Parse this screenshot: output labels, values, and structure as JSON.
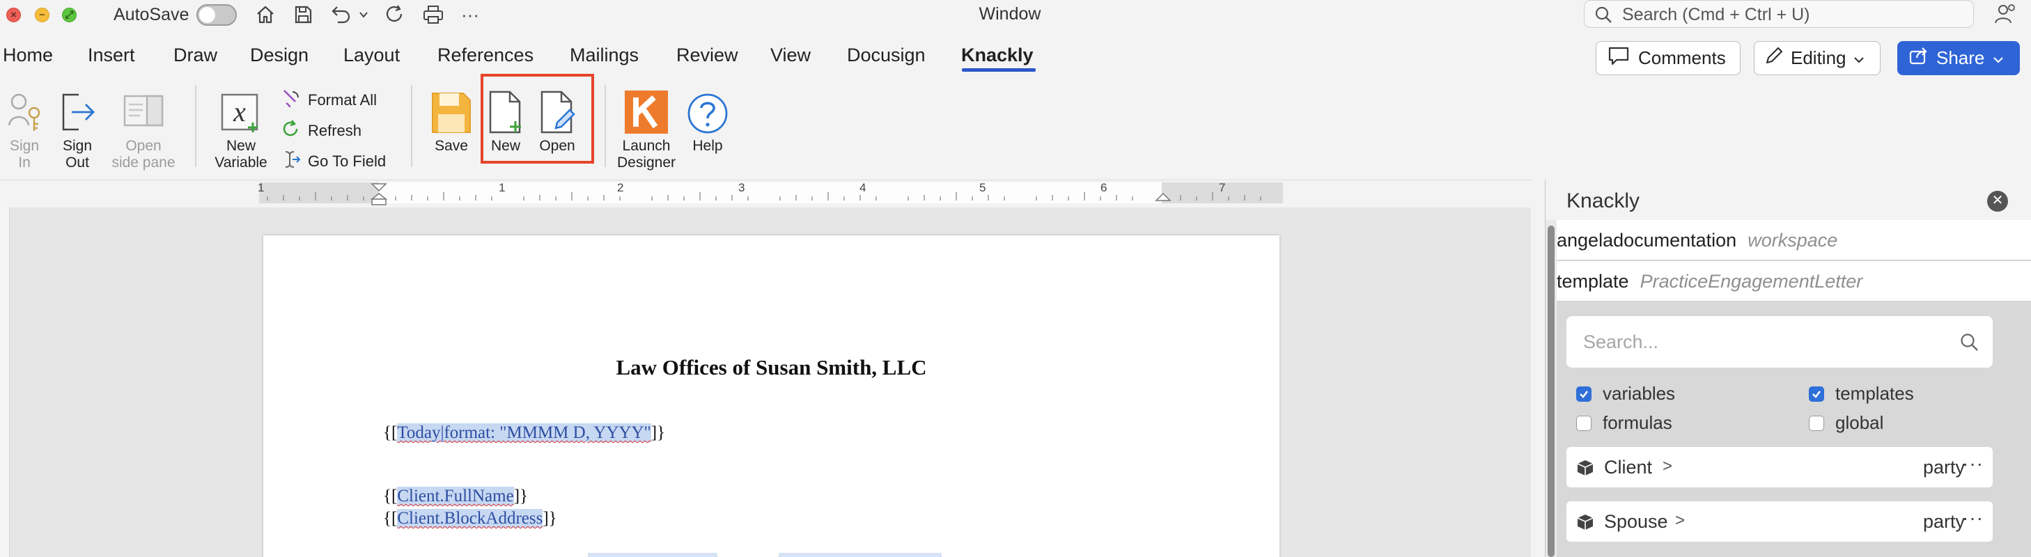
{
  "titlebar": {
    "autosave_label": "AutoSave",
    "window_title": "Window",
    "search_placeholder": "Search (Cmd + Ctrl + U)"
  },
  "tabs": [
    {
      "label": "Home"
    },
    {
      "label": "Insert"
    },
    {
      "label": "Draw"
    },
    {
      "label": "Design"
    },
    {
      "label": "Layout"
    },
    {
      "label": "References"
    },
    {
      "label": "Mailings"
    },
    {
      "label": "Review"
    },
    {
      "label": "View"
    },
    {
      "label": "Docusign"
    },
    {
      "label": "Knackly",
      "active": true
    }
  ],
  "actions": {
    "comments": "Comments",
    "editing": "Editing",
    "share": "Share"
  },
  "ribbon": {
    "sign_in": [
      "Sign",
      "In"
    ],
    "sign_out": [
      "Sign",
      "Out"
    ],
    "open_side_pane": [
      "Open",
      "side pane"
    ],
    "new_variable": [
      "New",
      "Variable"
    ],
    "format_all": "Format All",
    "refresh": "Refresh",
    "go_to_field": "Go To Field",
    "save": "Save",
    "new": "New",
    "open": "Open",
    "launch_designer": [
      "Launch",
      "Designer"
    ],
    "help": "Help"
  },
  "ruler": {
    "numbers": [
      "1",
      "1",
      "2",
      "3",
      "4",
      "5",
      "6",
      "7"
    ]
  },
  "document": {
    "heading": "Law Offices of Susan Smith, LLC",
    "date_open": "{[",
    "date_field": "Today|format: \"MMMM D, YYYY\"",
    "date_close": "]}",
    "client_open": "{[",
    "client_field": "Client.FullName",
    "client_close": "]}",
    "address_open": "{[",
    "address_field": "Client.BlockAddress",
    "address_close": "]}"
  },
  "pane": {
    "title": "Knackly",
    "workspace_name": "angeladocumentation",
    "workspace_label": "workspace",
    "template_key": "template",
    "template_name": "PracticeEngagementLetter",
    "search_placeholder": "Search...",
    "filters": [
      {
        "label": "variables",
        "checked": true
      },
      {
        "label": "templates",
        "checked": true
      },
      {
        "label": "formulas",
        "checked": false
      },
      {
        "label": "global",
        "checked": false
      }
    ],
    "items": [
      {
        "name": "Client",
        "type": "party",
        "more": "···"
      },
      {
        "name": "Spouse",
        "type": "party",
        "more": "···"
      }
    ]
  },
  "colors": {
    "accent": "#2f64d6",
    "highlight_box": "#e5452b",
    "field_bg": "#c7d8f2",
    "knackly_orange": "#ee7b2c"
  }
}
